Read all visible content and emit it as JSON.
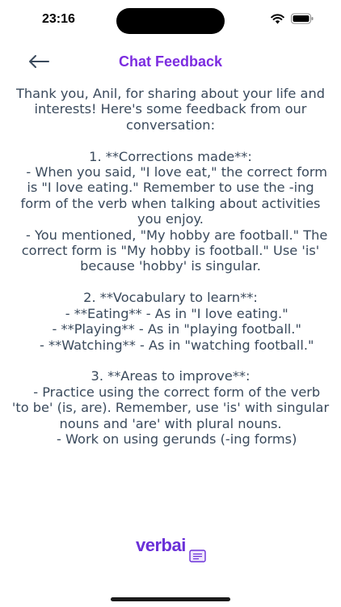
{
  "status_bar": {
    "time": "23:16"
  },
  "header": {
    "title": "Chat Feedback"
  },
  "feedback_text": "Thank you, Anil, for sharing about your life and interests! Here's some feedback from our conversation:\n\n1. **Corrections made**:\n   - When you said, \"I love eat,\" the correct form is \"I love eating.\" Remember to use the -ing form of the verb when talking about activities you enjoy.\n   - You mentioned, \"My hobby are football.\" The correct form is \"My hobby is football.\" Use 'is' because 'hobby' is singular.\n\n2. **Vocabulary to learn**:\n   - **Eating** - As in \"I love eating.\"\n   - **Playing** - As in \"playing football.\"\n   - **Watching** - As in \"watching football.\"\n\n3. **Areas to improve**:\n   - Practice using the correct form of the verb 'to be' (is, are). Remember, use 'is' with singular nouns and 'are' with plural nouns.\n   - Work on using gerunds (-ing forms)",
  "logo": {
    "text": "verbai",
    "icon": "chat-lines-icon"
  },
  "colors": {
    "accent": "#7c2de0",
    "text": "#3a4a5c"
  }
}
